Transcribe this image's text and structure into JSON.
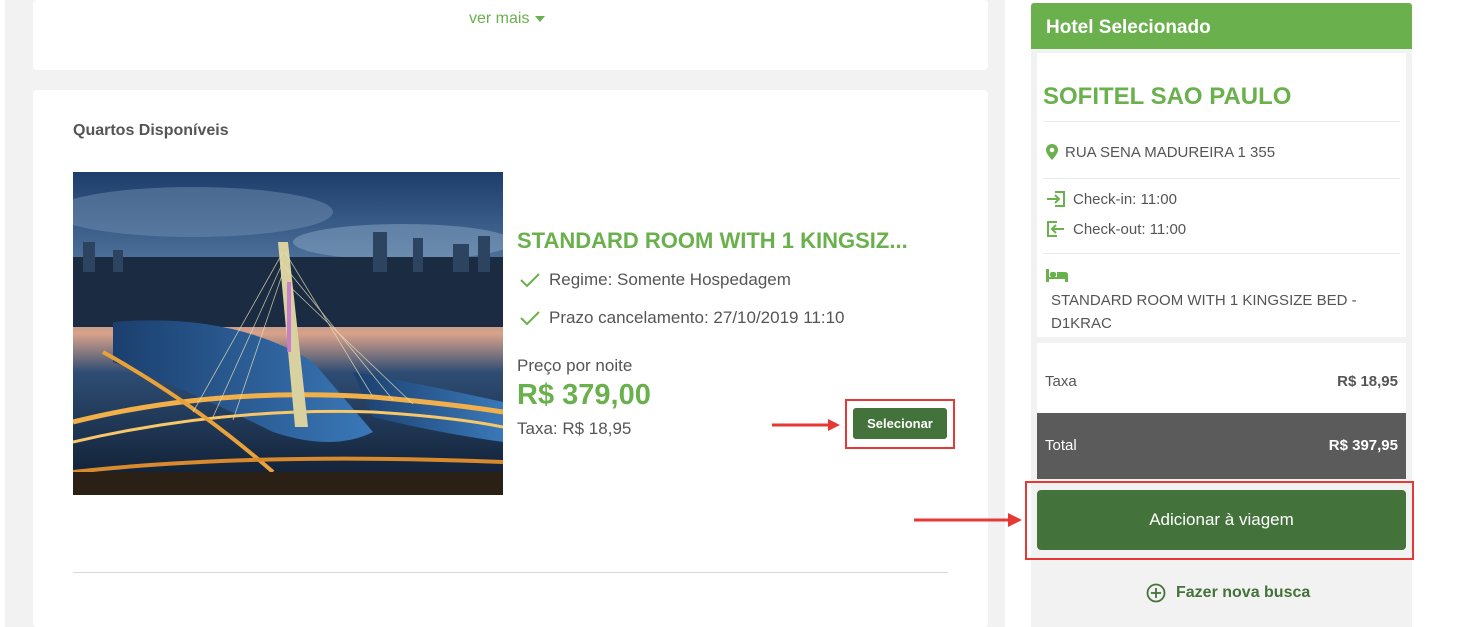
{
  "top_card": {
    "ver_mais": "ver mais"
  },
  "rooms": {
    "title": "Quartos Disponíveis",
    "room": {
      "name": "STANDARD ROOM WITH 1 KINGSIZ...",
      "regime": "Regime: Somente Hospedagem",
      "cancel": "Prazo cancelamento: 27/10/2019 11:10",
      "price_label": "Preço por noite",
      "price": "R$ 379,00",
      "tax": "Taxa: R$ 18,95",
      "select_label": "Selecionar"
    }
  },
  "sidebar": {
    "header": "Hotel Selecionado",
    "hotel_name": "SOFITEL SAO PAULO",
    "address": "RUA SENA MADUREIRA 1 355",
    "checkin": "Check-in: 11:00",
    "checkout": "Check-out: 11:00",
    "room_desc": "STANDARD ROOM WITH 1 KINGSIZE BED - D1KRAC",
    "fee_label": "Taxa",
    "fee_value": "R$ 18,95",
    "total_label": "Total",
    "total_value": "R$ 397,95",
    "add_label": "Adicionar à viagem",
    "new_search": "Fazer nova busca"
  },
  "colors": {
    "brand_green": "#6ab04c",
    "button_green": "#43733a",
    "highlight_red": "#e53935",
    "total_bg": "#5b5b5b"
  },
  "icons": [
    "chevron-down-icon",
    "checkmark-icon",
    "map-pin-icon",
    "check-in-icon",
    "check-out-icon",
    "bed-icon",
    "plus-circle-icon",
    "arrow-right-icon"
  ]
}
